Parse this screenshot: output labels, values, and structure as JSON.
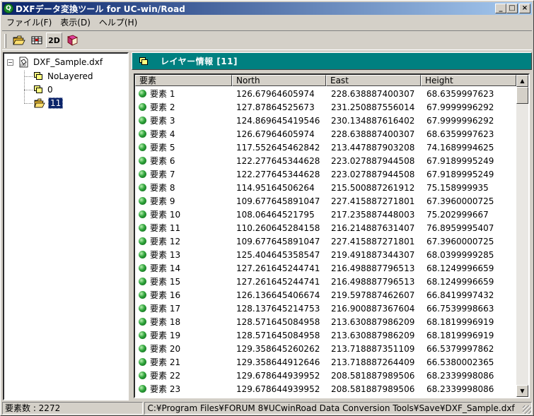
{
  "window": {
    "title": "DXFデータ変換ツール for UC-win/Road",
    "app_icon": "uc-win-road-icon",
    "controls": [
      "minimize",
      "maximize",
      "close"
    ]
  },
  "menu": [
    "ファイル(F)",
    "表示(D)",
    "ヘルプ(H)"
  ],
  "toolbar": {
    "buttons": [
      "open-folder-icon",
      "convert-icon",
      "2D",
      "book-icon"
    ]
  },
  "tree": {
    "root": "DXF_Sample.dxf",
    "children": [
      "NoLayered",
      "0",
      "11"
    ],
    "selected": "11"
  },
  "layer_panel": {
    "title": "レイヤー情報 [11]"
  },
  "table": {
    "columns": [
      "要素",
      "North",
      "East",
      "Height"
    ],
    "rows": [
      [
        "要素 1",
        "126.67964605974",
        "228.638887400307",
        "68.6359997623"
      ],
      [
        "要素 2",
        "127.87864525673",
        "231.250887556014",
        "67.9999996292"
      ],
      [
        "要素 3",
        "124.869645419546",
        "230.134887616402",
        "67.9999996292"
      ],
      [
        "要素 4",
        "126.67964605974",
        "228.638887400307",
        "68.6359997623"
      ],
      [
        "要素 5",
        "117.552645462842",
        "213.447887903208",
        "74.1689994625"
      ],
      [
        "要素 6",
        "122.277645344628",
        "223.027887944508",
        "67.9189995249"
      ],
      [
        "要素 7",
        "122.277645344628",
        "223.027887944508",
        "67.9189995249"
      ],
      [
        "要素 8",
        "114.95164506264",
        "215.500887261912",
        "75.158999935"
      ],
      [
        "要素 9",
        "109.677645891047",
        "227.415887271801",
        "67.3960000725"
      ],
      [
        "要素 10",
        "108.06464521795",
        "217.235887448003",
        "75.202999667"
      ],
      [
        "要素 11",
        "110.260645284158",
        "216.214887631407",
        "76.8959995407"
      ],
      [
        "要素 12",
        "109.677645891047",
        "227.415887271801",
        "67.3960000725"
      ],
      [
        "要素 13",
        "125.404645358547",
        "219.491887344307",
        "68.0399999285"
      ],
      [
        "要素 14",
        "127.261645244741",
        "216.498887796513",
        "68.1249996659"
      ],
      [
        "要素 15",
        "127.261645244741",
        "216.498887796513",
        "68.1249996659"
      ],
      [
        "要素 16",
        "126.136645406674",
        "219.597887462607",
        "66.8419997432"
      ],
      [
        "要素 17",
        "128.137645214753",
        "216.900887367604",
        "66.7539998663"
      ],
      [
        "要素 18",
        "128.571645084958",
        "213.630887986209",
        "68.1819996919"
      ],
      [
        "要素 19",
        "128.571645084958",
        "213.630887986209",
        "68.1819996919"
      ],
      [
        "要素 20",
        "129.358645260262",
        "213.718887351109",
        "66.5379997862"
      ],
      [
        "要素 21",
        "129.358644912646",
        "213.718887264409",
        "66.5380002365"
      ],
      [
        "要素 22",
        "129.678644939952",
        "208.581887989506",
        "68.2339998086"
      ],
      [
        "要素 23",
        "129.678644939952",
        "208.581887989506",
        "68.2339998086"
      ]
    ]
  },
  "status": {
    "count": "要素数 : 2272",
    "path": "C:¥Program Files¥FORUM 8¥UCwinRoad Data Conversion Tools¥Save¥DXF_Sample.dxf"
  },
  "colors": {
    "title_gradient_start": "#0a246a",
    "title_gradient_end": "#a6caf0",
    "header_band": "#008080",
    "selection": "#0a246a"
  }
}
